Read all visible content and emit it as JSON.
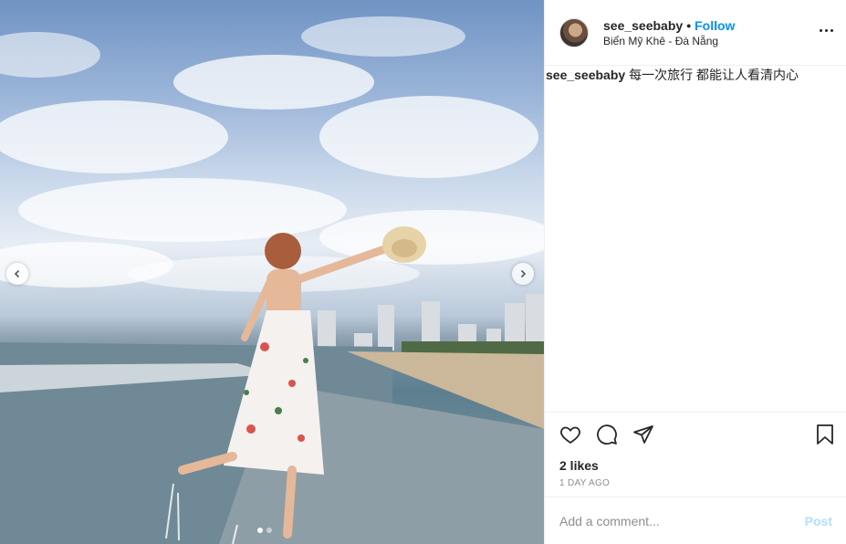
{
  "post": {
    "image_alt": "Woman in floral dress running on beach holding a straw hat, city skyline behind",
    "carousel": {
      "slide_count": 2,
      "active_index": 0,
      "prev_icon": "chevron-left-icon",
      "next_icon": "chevron-right-icon"
    }
  },
  "header": {
    "username": "see_seebaby",
    "separator": "•",
    "follow_label": "Follow",
    "location": "Biển Mỹ Khê - Đà Nẵng"
  },
  "caption": {
    "username": "see_seebaby",
    "text": "每一次旅行 都能让人看清内心"
  },
  "actions": {
    "like_icon": "heart-icon",
    "comment_icon": "comment-icon",
    "share_icon": "share-icon",
    "save_icon": "bookmark-icon"
  },
  "stats": {
    "likes": "2 likes",
    "timestamp": "1 DAY AGO"
  },
  "comment_box": {
    "placeholder": "Add a comment...",
    "post_label": "Post"
  },
  "colors": {
    "accent": "#0095f6",
    "post_disabled": "#b2dffc",
    "muted": "#8e8e8e",
    "border": "#efefef"
  }
}
